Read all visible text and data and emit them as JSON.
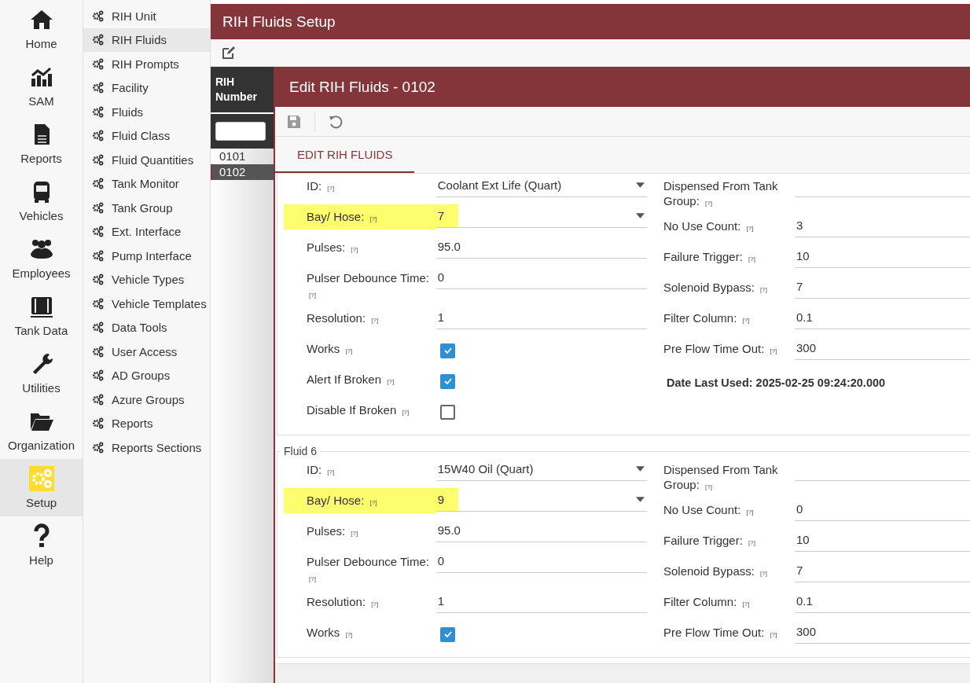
{
  "nav": [
    {
      "label": "Home",
      "selected": false
    },
    {
      "label": "SAM",
      "selected": false
    },
    {
      "label": "Reports",
      "selected": false
    },
    {
      "label": "Vehicles",
      "selected": false
    },
    {
      "label": "Employees",
      "selected": false
    },
    {
      "label": "Tank Data",
      "selected": false
    },
    {
      "label": "Utilities",
      "selected": false
    },
    {
      "label": "Organization",
      "selected": false
    },
    {
      "label": "Setup",
      "selected": true
    },
    {
      "label": "Help",
      "selected": false
    }
  ],
  "submenu": [
    {
      "label": "RIH Unit",
      "selected": false
    },
    {
      "label": "RIH Fluids",
      "selected": true
    },
    {
      "label": "RIH Prompts",
      "selected": false
    },
    {
      "label": "Facility",
      "selected": false
    },
    {
      "label": "Fluids",
      "selected": false
    },
    {
      "label": "Fluid Class",
      "selected": false
    },
    {
      "label": "Fluid Quantities",
      "selected": false
    },
    {
      "label": "Tank Monitor",
      "selected": false
    },
    {
      "label": "Tank Group",
      "selected": false
    },
    {
      "label": "Ext. Interface",
      "selected": false
    },
    {
      "label": "Pump Interface",
      "selected": false
    },
    {
      "label": "Vehicle Types",
      "selected": false
    },
    {
      "label": "Vehicle Templates",
      "selected": false
    },
    {
      "label": "Data Tools",
      "selected": false
    },
    {
      "label": "User Access",
      "selected": false
    },
    {
      "label": "AD Groups",
      "selected": false
    },
    {
      "label": "Azure Groups",
      "selected": false
    },
    {
      "label": "Reports",
      "selected": false
    },
    {
      "label": "Reports Sections",
      "selected": false
    }
  ],
  "page_title": "RIH Fluids Setup",
  "list": {
    "header": "RIH Number",
    "rows": [
      {
        "label": "0101",
        "selected": false
      },
      {
        "label": "0102",
        "selected": true
      }
    ]
  },
  "dialog": {
    "title": "Edit RIH Fluids - 0102",
    "tabs": [
      {
        "label": "EDIT RIH FLUIDS",
        "selected": true
      }
    ],
    "sections": [
      {
        "left": [
          {
            "kind": "select",
            "label": "ID:",
            "help": "[?]",
            "value": "Coolant Ext Life (Quart)",
            "highlighted": false
          },
          {
            "kind": "select",
            "label": "Bay/ Hose:",
            "help": "[?]",
            "value": "7",
            "highlighted": true
          },
          {
            "kind": "text",
            "label": "Pulses:",
            "help": "[?]",
            "value": "95.0",
            "highlighted": false
          },
          {
            "kind": "text",
            "label": "Pulser Debounce Time:",
            "help": "[?]",
            "value": "0",
            "highlighted": false
          },
          {
            "kind": "text",
            "label": "Resolution:",
            "help": "[?]",
            "value": "1",
            "highlighted": false
          },
          {
            "kind": "checkbox",
            "label": "Works",
            "help": "[?]",
            "checked": true,
            "highlighted": false
          },
          {
            "kind": "checkbox",
            "label": "Alert If Broken",
            "help": "[?]",
            "checked": true,
            "highlighted": false
          },
          {
            "kind": "checkbox",
            "label": "Disable If Broken",
            "help": "[?]",
            "checked": false,
            "highlighted": false
          }
        ],
        "right": [
          {
            "label": "Dispensed From Tank Group:",
            "help": "[?]"
          },
          {
            "label": "No Use Count:",
            "help": "[?]",
            "value": "3"
          },
          {
            "label": "Failure Trigger:",
            "help": "[?]",
            "value": "10"
          },
          {
            "label": "Solenoid Bypass:",
            "help": "[?]",
            "value": "7"
          },
          {
            "label": "Filter Column:",
            "help": "[?]",
            "value": "0.1"
          },
          {
            "label": "Pre Flow Time Out:",
            "help": "[?]",
            "value": "300"
          }
        ],
        "date_last_used": "Date Last Used: 2025-02-25 09:24:20.000"
      },
      {
        "legend": "Fluid 6",
        "left": [
          {
            "kind": "select",
            "label": "ID:",
            "help": "[?]",
            "value": "15W40 Oil (Quart)",
            "highlighted": false
          },
          {
            "kind": "select",
            "label": "Bay/ Hose:",
            "help": "[?]",
            "value": "9",
            "highlighted": true
          },
          {
            "kind": "text",
            "label": "Pulses:",
            "help": "[?]",
            "value": "95.0",
            "highlighted": false
          },
          {
            "kind": "text",
            "label": "Pulser Debounce Time:",
            "help": "[?]",
            "value": "0",
            "highlighted": false
          },
          {
            "kind": "text",
            "label": "Resolution:",
            "help": "[?]",
            "value": "1",
            "highlighted": false
          },
          {
            "kind": "checkbox",
            "label": "Works",
            "help": "[?]",
            "checked": true,
            "highlighted": false
          }
        ],
        "right": [
          {
            "label": "Dispensed From Tank Group:",
            "help": "[?]"
          },
          {
            "label": "No Use Count:",
            "help": "[?]",
            "value": "0"
          },
          {
            "label": "Failure Trigger:",
            "help": "[?]",
            "value": "10"
          },
          {
            "label": "Solenoid Bypass:",
            "help": "[?]",
            "value": "7"
          },
          {
            "label": "Filter Column:",
            "help": "[?]",
            "value": "0.1"
          },
          {
            "label": "Pre Flow Time Out:",
            "help": "[?]",
            "value": "300"
          }
        ]
      }
    ]
  }
}
